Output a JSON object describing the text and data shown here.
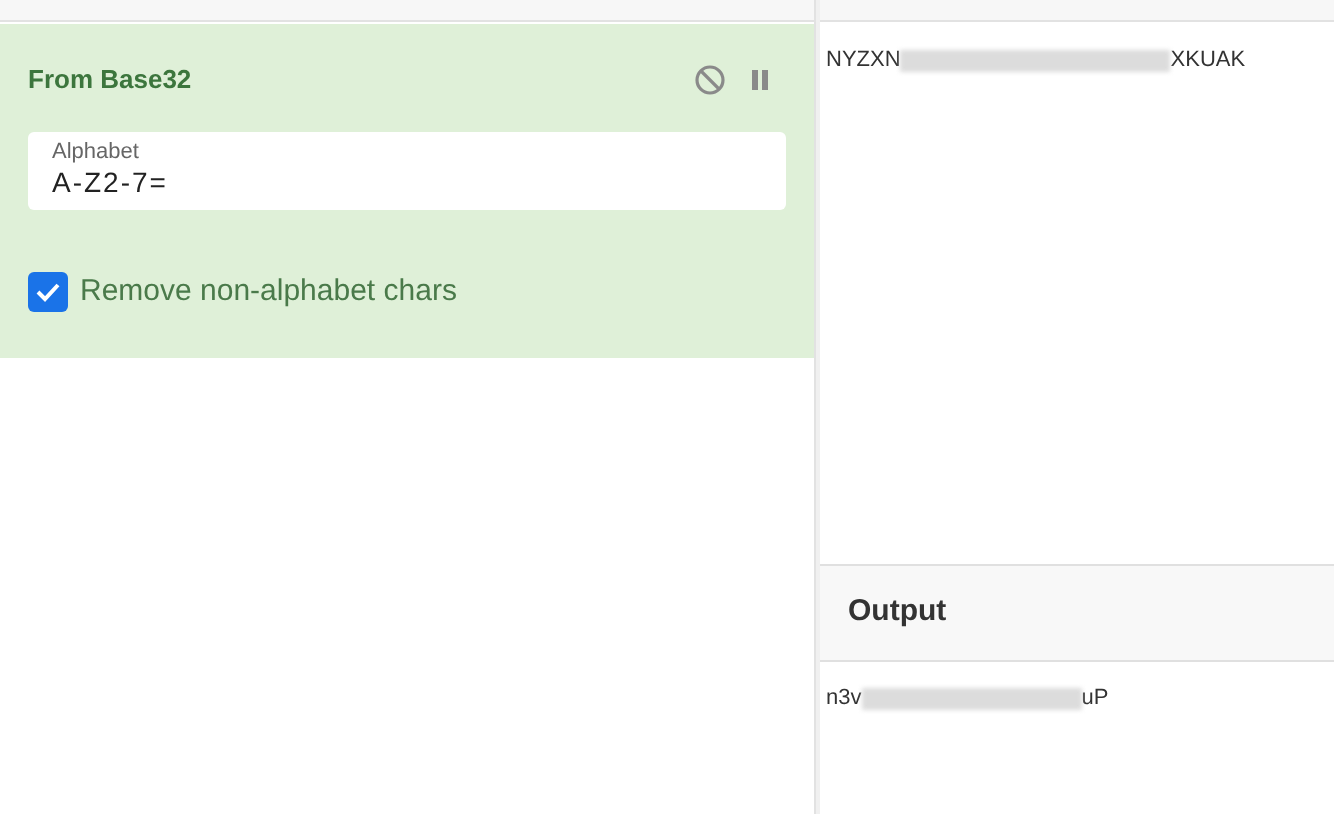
{
  "recipe": {
    "operation": {
      "title": "From Base32",
      "disabled": false,
      "paused": false,
      "fields": [
        {
          "label": "Alphabet",
          "value": "A-Z2-7="
        }
      ],
      "options": [
        {
          "label": "Remove non-alphabet chars",
          "checked": true
        }
      ]
    }
  },
  "input": {
    "start": "NYZXN",
    "end": "XKUAK",
    "redacted": true
  },
  "output": {
    "title": "Output",
    "start": "n3v",
    "end": "uP",
    "redacted": true
  }
}
